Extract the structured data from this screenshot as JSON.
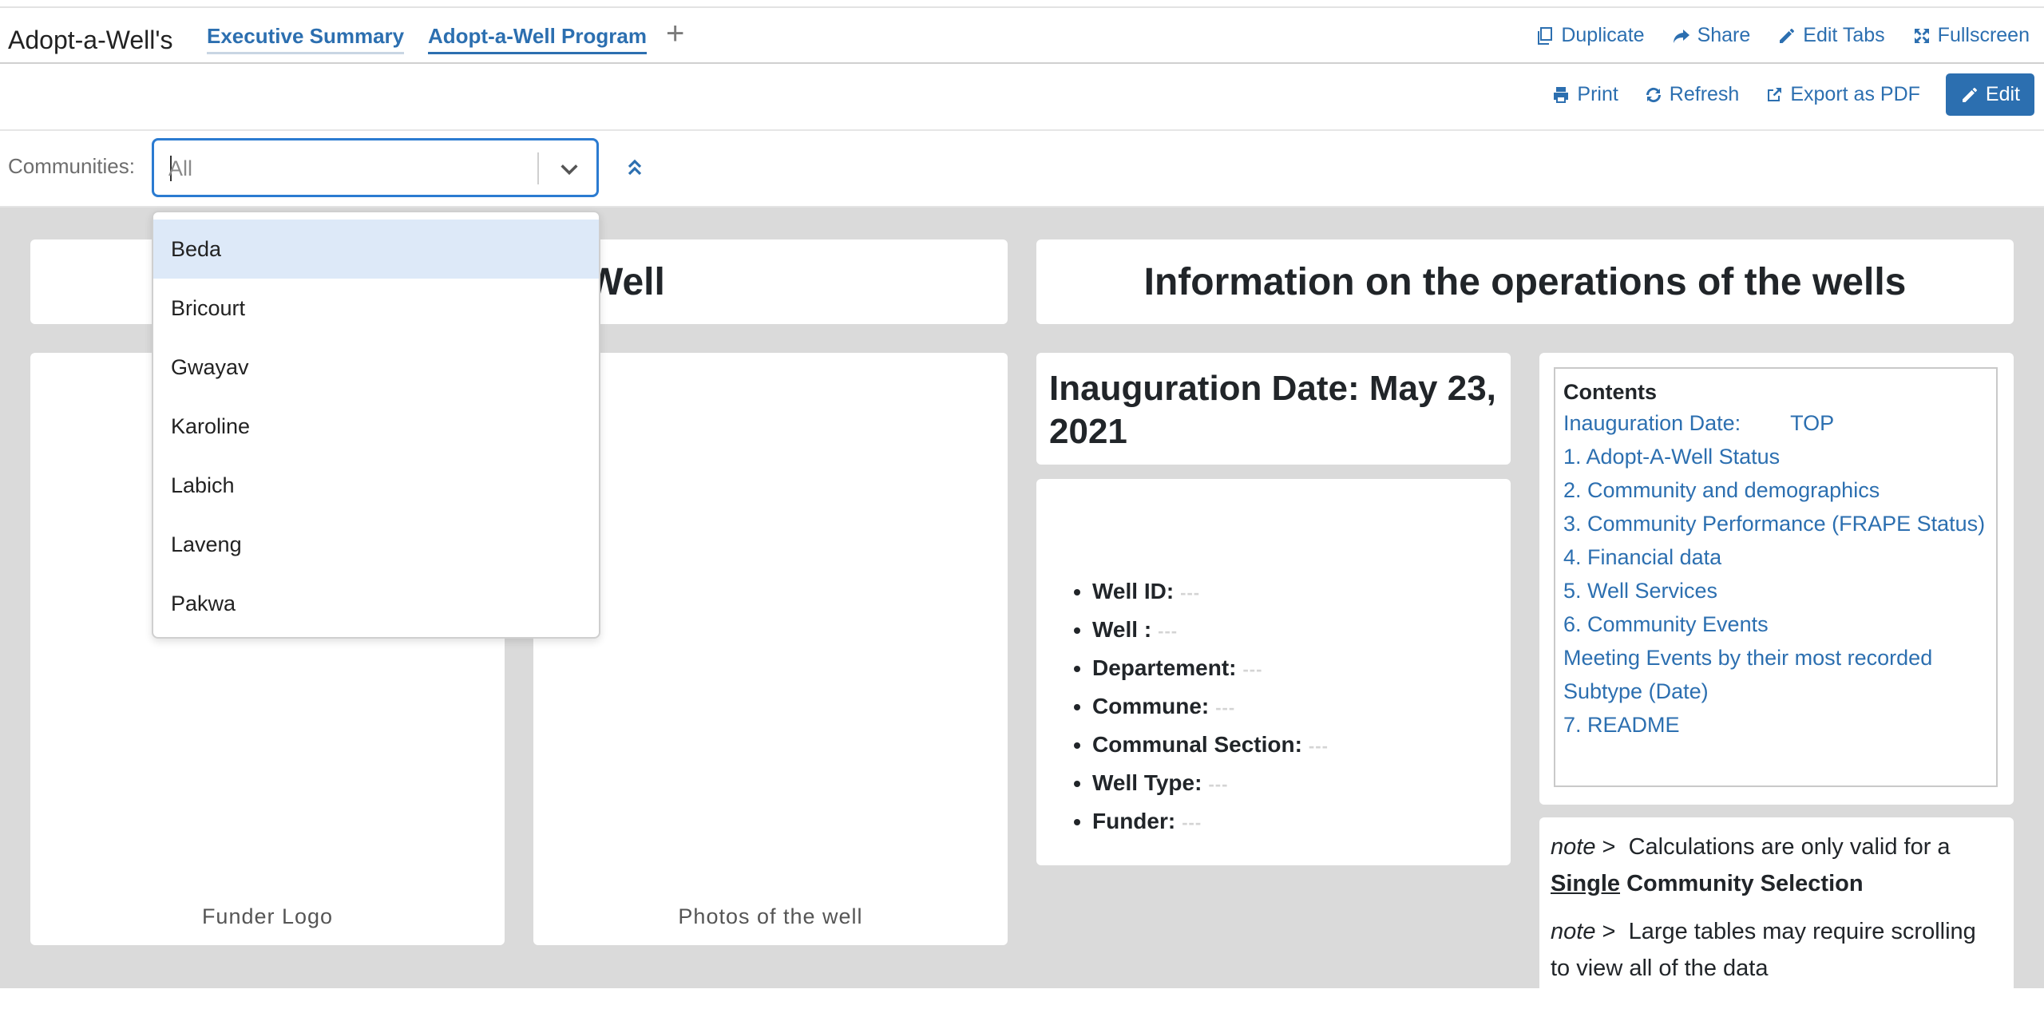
{
  "app": {
    "title": "Adopt-a-Well's"
  },
  "tabs": [
    {
      "label": "Executive Summary"
    },
    {
      "label": "Adopt-a-Well Program",
      "active": true
    }
  ],
  "add_tab_icon": "plus-icon",
  "top_actions": [
    {
      "label": "Duplicate",
      "icon": "duplicate-icon"
    },
    {
      "label": "Share",
      "icon": "share-icon"
    },
    {
      "label": "Edit Tabs",
      "icon": "pencil-icon"
    },
    {
      "label": "Fullscreen",
      "icon": "expand-icon"
    }
  ],
  "toolbar": {
    "print": "Print",
    "refresh": "Refresh",
    "export": "Export as PDF",
    "edit": "Edit"
  },
  "filter": {
    "label": "Communities:",
    "value": "All",
    "options": [
      "Beda",
      "Bricourt",
      "Gwayav",
      "Karoline",
      "Labich",
      "Laveng",
      "Pakwa"
    ],
    "highlighted": "Beda"
  },
  "dashboard": {
    "left_header_visible": "Well",
    "right_header": "Information on the operations of the wells",
    "logo_caption": "Funder Logo",
    "photo_caption": "Photos of the well",
    "inauguration": "Inauguration Date: May 23, 2021",
    "info": [
      {
        "label": "Well ID:",
        "value": "---"
      },
      {
        "label": "Well :",
        "value": "---"
      },
      {
        "label": "Departement:",
        "value": "---"
      },
      {
        "label": "Commune:",
        "value": "---"
      },
      {
        "label": "Communal Section:",
        "value": "---"
      },
      {
        "label": "Well Type:",
        "value": "---"
      },
      {
        "label": "Funder:",
        "value": "---"
      }
    ],
    "contents": {
      "title": "Contents",
      "first_item": "Inauguration Date:",
      "first_item_link": "TOP",
      "items": [
        "1. Adopt-A-Well  Status",
        "2. Community and demographics",
        "3. Community Performance (FRAPE Status)",
        "4. Financial data",
        "5. Well Services",
        "6. Community Events",
        "Meeting Events by their most recorded Subtype (Date)",
        "7. README"
      ]
    },
    "notes": {
      "prefix": "note",
      "arrow": ">",
      "note1_text": "Calculations are only valid for a",
      "note1_emph": "Single",
      "note1_tail": "Community Selection",
      "note2_text": "Large tables may require scrolling to view all of the data"
    }
  },
  "colors": {
    "accent": "#2c6fb0",
    "canvas": "#dadada",
    "focus": "#2b7bd1",
    "hover": "#dde9f8"
  }
}
